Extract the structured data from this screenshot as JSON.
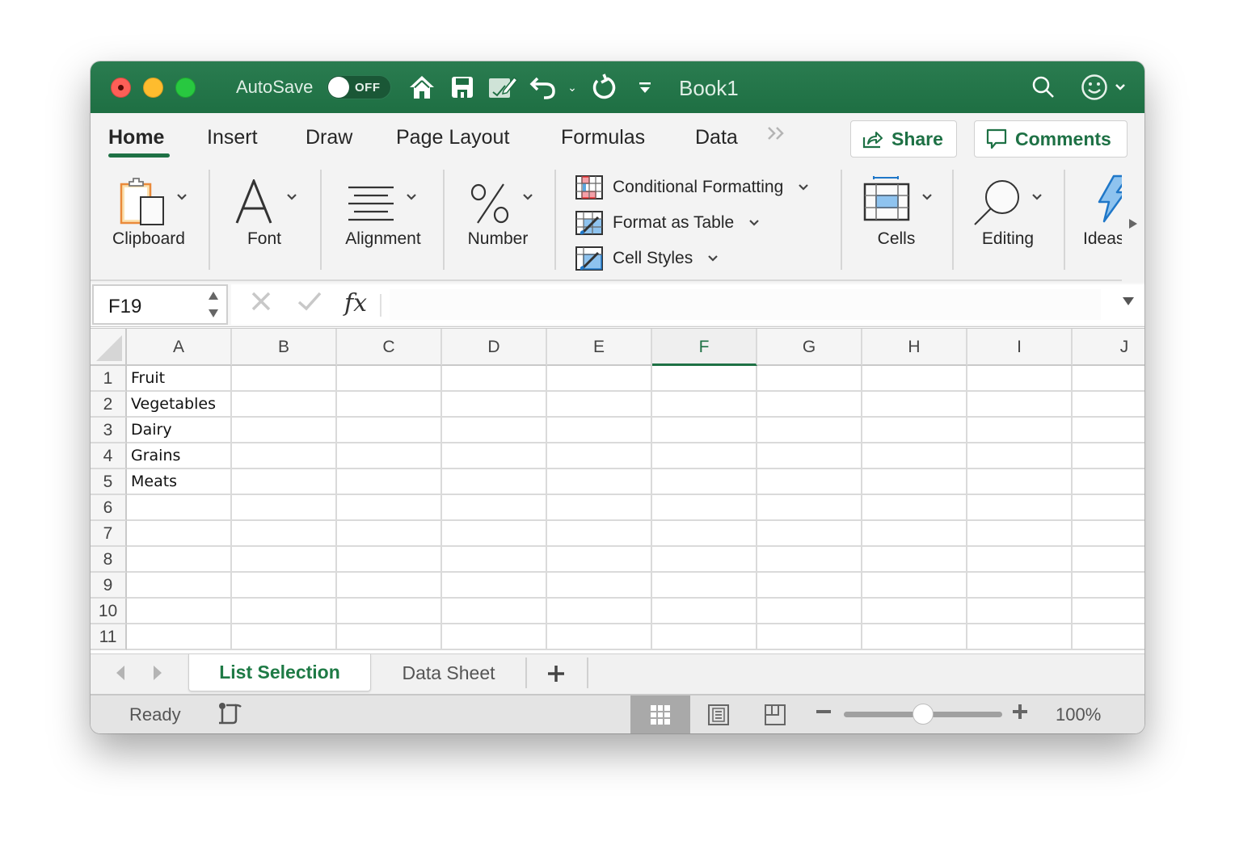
{
  "titlebar": {
    "autosave_label": "AutoSave",
    "autosave_state": "OFF",
    "document_title": "Book1",
    "icons": [
      "home-icon",
      "save-icon",
      "edit-document-icon",
      "undo-icon",
      "undo-dropdown-icon",
      "redo-icon",
      "customize-toolbar-icon",
      "search-icon",
      "feedback-smiley-icon"
    ]
  },
  "tabs": [
    {
      "label": "Home",
      "active": true
    },
    {
      "label": "Insert",
      "active": false
    },
    {
      "label": "Draw",
      "active": false
    },
    {
      "label": "Page Layout",
      "active": false
    },
    {
      "label": "Formulas",
      "active": false
    },
    {
      "label": "Data",
      "active": false
    }
  ],
  "tabs_overflow": "»",
  "share_label": "Share",
  "comments_label": "Comments",
  "ribbon": {
    "clipboard": "Clipboard",
    "font": "Font",
    "alignment": "Alignment",
    "number": "Number",
    "styles": [
      "Conditional Formatting",
      "Format as Table",
      "Cell Styles"
    ],
    "cells": "Cells",
    "editing": "Editing",
    "ideas": "Ideas"
  },
  "formula_bar": {
    "name_box": "F19",
    "fx_label": "fx",
    "formula_value": ""
  },
  "grid": {
    "columns": [
      "A",
      "B",
      "C",
      "D",
      "E",
      "F",
      "G",
      "H",
      "I",
      "J"
    ],
    "selected_column": "F",
    "rows": [
      "1",
      "2",
      "3",
      "4",
      "5",
      "6",
      "7",
      "8",
      "9",
      "10",
      "11"
    ],
    "column_a_values": [
      "Fruit",
      "Vegetables",
      "Dairy",
      "Grains",
      "Meats",
      "",
      "",
      "",
      "",
      "",
      ""
    ]
  },
  "sheets": [
    {
      "label": "List Selection",
      "active": true
    },
    {
      "label": "Data Sheet",
      "active": false
    }
  ],
  "add_sheet": "+",
  "status": {
    "text": "Ready",
    "zoom_level": "100%",
    "zoom_slider_fraction": 0.5,
    "active_view": "normal"
  },
  "colors": {
    "accent": "#1e7145",
    "titlebar": "#217346"
  }
}
